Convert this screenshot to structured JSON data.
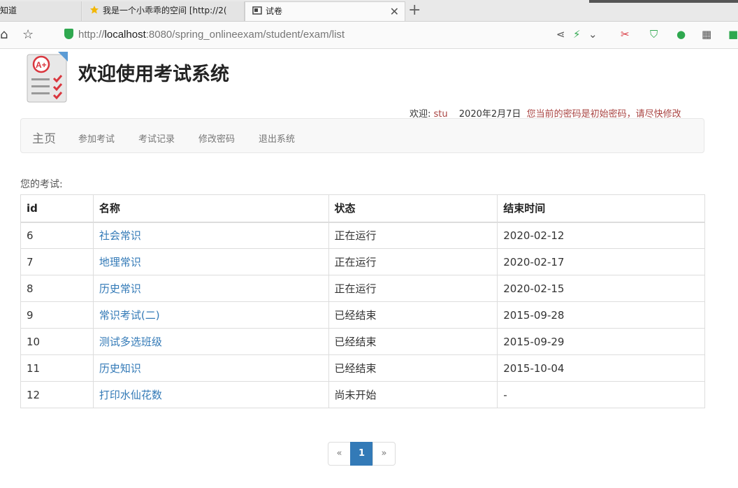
{
  "browser": {
    "tabs": [
      {
        "label": "知道",
        "active": false
      },
      {
        "label": "我是一个小乖乖的空间 [http://2(",
        "active": false
      },
      {
        "label": "试卷",
        "active": true
      }
    ],
    "new_tab": "+",
    "url_scheme": "http://",
    "url_host": "localhost",
    "url_path": ":8080/spring_onlineexam/student/exam/list"
  },
  "header": {
    "title": "欢迎使用考试系统",
    "welcome_label": "欢迎:",
    "username": "stu",
    "date": "2020年2月7日",
    "warning": "您当前的密码是初始密码，请尽快修改"
  },
  "navbar": {
    "brand": "主页",
    "links": [
      "参加考试",
      "考试记录",
      "修改密码",
      "退出系统"
    ]
  },
  "exams": {
    "caption": "您的考试:",
    "columns": [
      "id",
      "名称",
      "状态",
      "结束时间"
    ],
    "rows": [
      {
        "id": "6",
        "name": "社会常识",
        "status": "正在运行",
        "status_type": "running",
        "end": "2020-02-12"
      },
      {
        "id": "7",
        "name": "地理常识",
        "status": "正在运行",
        "status_type": "running",
        "end": "2020-02-17"
      },
      {
        "id": "8",
        "name": "历史常识",
        "status": "正在运行",
        "status_type": "running",
        "end": "2020-02-15"
      },
      {
        "id": "9",
        "name": "常识考试(二)",
        "status": "已经结束",
        "status_type": "ended",
        "end": "2015-09-28"
      },
      {
        "id": "10",
        "name": "测试多选班级",
        "status": "已经结束",
        "status_type": "ended",
        "end": "2015-09-29"
      },
      {
        "id": "11",
        "name": "历史知识",
        "status": "已经结束",
        "status_type": "ended",
        "end": "2015-10-04"
      },
      {
        "id": "12",
        "name": "打印水仙花数",
        "status": "尚未开始",
        "status_type": "pending",
        "end": "-"
      }
    ]
  },
  "pagination": {
    "prev": "«",
    "current": "1",
    "next": "»"
  },
  "colors": {
    "link": "#337ab7",
    "running": "#3c763d",
    "ended": "#a94442"
  }
}
